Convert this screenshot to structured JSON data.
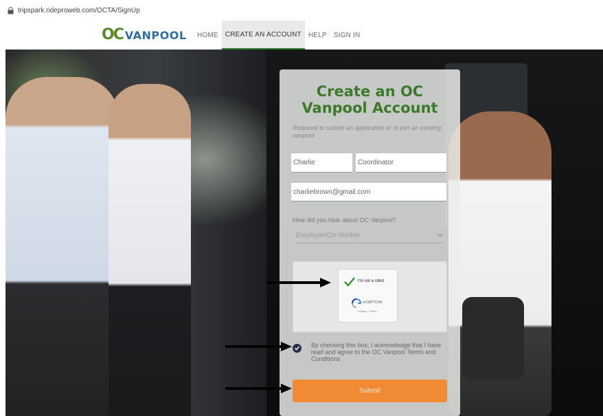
{
  "browser": {
    "url": "tripspark.rideproweb.com/OCTA/SignUp"
  },
  "nav": {
    "logo_oc": "OC",
    "logo_vanpool": "VANPOOL",
    "items": [
      {
        "label": "HOME"
      },
      {
        "label": "CREATE AN ACCOUNT",
        "active": true
      },
      {
        "label": "HELP"
      },
      {
        "label": "SIGN IN"
      }
    ]
  },
  "form": {
    "title_line1": "Create an OC",
    "title_line2": "Vanpool Account",
    "subtitle": "Required to submit an application or to join an existing vanpool",
    "first_name": "Charlie",
    "last_name": "Coordinator",
    "email": "charliebrown@gmail.com",
    "referral_label": "How did you hear about OC Vanpool?",
    "referral_value": "Employer/Co-Worker",
    "recaptcha": {
      "label": "I'm not a robot",
      "brand": "reCAPTCHA",
      "links": "Privacy - Terms"
    },
    "agree_text": "By checking this box, I acknowledge that I have read and agree to the OC Vanpool Terms and Conditions",
    "agree_checked": true,
    "submit_label": "Submit"
  },
  "colors": {
    "brand_green": "#3c7a2a",
    "brand_blue": "#2f6fa0",
    "submit_orange": "#f08a34",
    "checkbox_navy": "#2c2f4a"
  },
  "icons": [
    "lock-icon",
    "chevron-down-icon",
    "checkmark-icon",
    "recaptcha-logo-icon",
    "arrow-right-icon"
  ]
}
